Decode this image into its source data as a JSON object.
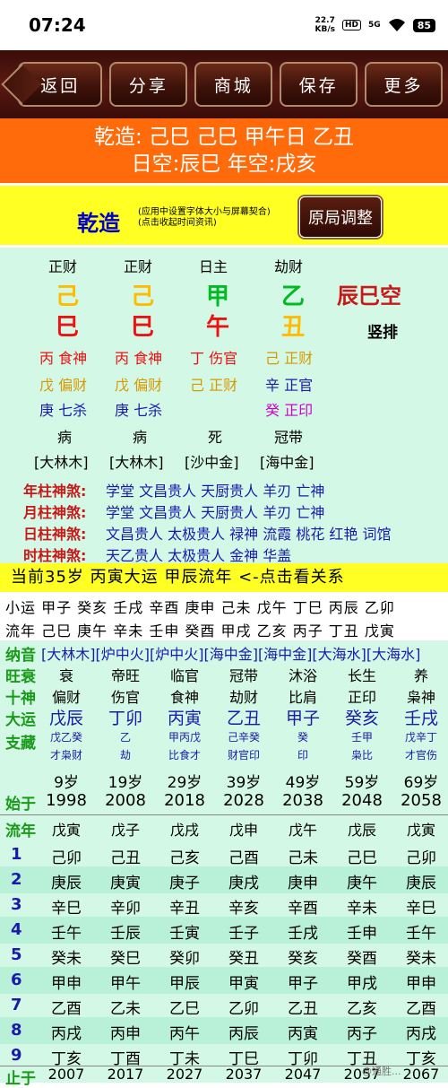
{
  "status": {
    "time": "07:24",
    "speed_top": "22.7",
    "speed_unit": "KB/s",
    "hd": "HD",
    "net": "5G",
    "battery": "85"
  },
  "toolbar": {
    "back": "返回",
    "share": "分享",
    "mall": "商城",
    "save": "保存",
    "more": "更多"
  },
  "header": {
    "line1": "乾造: 己巳 己巳 甲午日 乙丑",
    "line2": "日空:辰巳 年空:戌亥"
  },
  "panel": {
    "title": "乾造",
    "note1": "(应用中设置字体大小与屏幕契合)",
    "note2": "(点击收起时间资讯)",
    "adjust_button": "原局调整"
  },
  "pillars": {
    "tenGods": [
      "正财",
      "正财",
      "日主",
      "劫财"
    ],
    "stems": [
      "己",
      "己",
      "甲",
      "乙"
    ],
    "stemColors": [
      "#ffbb00",
      "#ffbb00",
      "#00bb22",
      "#00bb22"
    ],
    "branches": [
      "巳",
      "巳",
      "午",
      "丑"
    ],
    "branchColors": [
      "#ee1111",
      "#ee1111",
      "#ee1111",
      "#ffbb00"
    ],
    "empty": "辰巳空",
    "vertical": "竖排",
    "hidden1": [
      "丙 食神",
      "丙 食神",
      "丁 伤官",
      "己 正财"
    ],
    "hidden1Colors": [
      "#ee1111",
      "#ee1111",
      "#ee1111",
      "#d89800"
    ],
    "hidden2": [
      "戊 偏财",
      "戊 偏财",
      "己 正财",
      "辛 正官"
    ],
    "hidden2Colors": [
      "#d89800",
      "#d89800",
      "#d89800",
      "#1a1aaa"
    ],
    "hidden3": [
      "庚 七杀",
      "庚 七杀",
      "",
      "癸 正印"
    ],
    "hidden3Colors": [
      "#1a1aaa",
      "#1a1aaa",
      "#000000",
      "#cc00cc"
    ],
    "stages": [
      "病",
      "病",
      "死",
      "冠带"
    ],
    "nayin": [
      "[大林木]",
      "[大林木]",
      "[沙中金]",
      "[海中金]"
    ]
  },
  "shensha": [
    {
      "label": "年柱神煞:",
      "value": "学堂 文昌贵人 天厨贵人 羊刃 亡神"
    },
    {
      "label": "月柱神煞:",
      "value": "学堂 文昌贵人 天厨贵人 羊刃 亡神"
    },
    {
      "label": "日柱神煞:",
      "value": "文昌贵人 太极贵人 禄神 流霞 桃花 红艳 词馆"
    },
    {
      "label": "时柱神煞:",
      "value": "天乙贵人 太极贵人 金神 华盖"
    }
  ],
  "dayunBar": "当前35岁 丙寅大运 甲辰流年   <-点击看关系",
  "xiaoyun": "小运  甲子 癸亥 壬戌 辛酉 庚申 己未 戊午 丁巳 丙辰 乙卯",
  "liunian": "流年  己巳 庚午 辛未 壬申 癸酉 甲戌 乙亥 丙子 丁丑 戊寅",
  "labels": {
    "nayin": "纳音",
    "wangshuai": "旺衰",
    "shishen": "十神",
    "dayun": "大运",
    "zhicang": "支藏",
    "shiyu": "始于",
    "liunian": "流年",
    "zhiyu": "止于"
  },
  "nayinRow": "[大林木][炉中火][炉中火][海中金][海中金][大海水][大海水]",
  "wangshuai": [
    "衰",
    "帝旺",
    "临官",
    "冠带",
    "沐浴",
    "长生",
    "养"
  ],
  "shishen": [
    "偏财",
    "伤官",
    "食神",
    "劫财",
    "比肩",
    "正印",
    "枭神"
  ],
  "dayun": [
    "戊辰",
    "丁卯",
    "丙寅",
    "乙丑",
    "甲子",
    "癸亥",
    "壬戌"
  ],
  "zhicang1": [
    "戊乙癸",
    "乙",
    "甲丙戊",
    "己辛癸",
    "癸",
    "壬甲",
    "戊辛丁"
  ],
  "zhicang2": [
    "才枭财",
    "劫",
    "比食才",
    "财官印",
    "印",
    "枭比",
    "才官伤"
  ],
  "ages": [
    "9岁",
    "19岁",
    "29岁",
    "39岁",
    "49岁",
    "59岁",
    "69岁"
  ],
  "startYears": [
    "1998",
    "2008",
    "2018",
    "2028",
    "2038",
    "2048",
    "2058"
  ],
  "liunianHeader": [
    "戊寅",
    "戊子",
    "戊戌",
    "戊申",
    "戊午",
    "戊辰",
    "戊寅"
  ],
  "grid": [
    {
      "n": "1",
      "cells": [
        "己卯",
        "己丑",
        "己亥",
        "己酉",
        "己未",
        "己巳",
        "己卯"
      ]
    },
    {
      "n": "2",
      "cells": [
        "庚辰",
        "庚寅",
        "庚子",
        "庚戌",
        "庚申",
        "庚午",
        "庚辰"
      ]
    },
    {
      "n": "3",
      "cells": [
        "辛巳",
        "辛卯",
        "辛丑",
        "辛亥",
        "辛酉",
        "辛未",
        "辛巳"
      ]
    },
    {
      "n": "4",
      "cells": [
        "壬午",
        "壬辰",
        "壬寅",
        "壬子",
        "壬戌",
        "壬申",
        "壬午"
      ]
    },
    {
      "n": "5",
      "cells": [
        "癸未",
        "癸巳",
        "癸卯",
        "癸丑",
        "癸亥",
        "癸酉",
        "癸未"
      ]
    },
    {
      "n": "6",
      "cells": [
        "甲申",
        "甲午",
        "甲辰",
        "甲寅",
        "甲子",
        "甲戌",
        "甲申"
      ]
    },
    {
      "n": "7",
      "cells": [
        "乙酉",
        "乙未",
        "乙巳",
        "乙卯",
        "乙丑",
        "乙亥",
        "乙酉"
      ]
    },
    {
      "n": "8",
      "cells": [
        "丙戌",
        "丙申",
        "丙午",
        "丙辰",
        "丙寅",
        "丙子",
        "丙戌"
      ]
    },
    {
      "n": "9",
      "cells": [
        "丁亥",
        "丁酉",
        "丁未",
        "丁巳",
        "丁卯",
        "丁丑",
        "丁亥"
      ]
    }
  ],
  "endYears": [
    "2007",
    "2017",
    "2027",
    "2037",
    "2047",
    "2057",
    "2067"
  ],
  "watermark": "@通胜..."
}
